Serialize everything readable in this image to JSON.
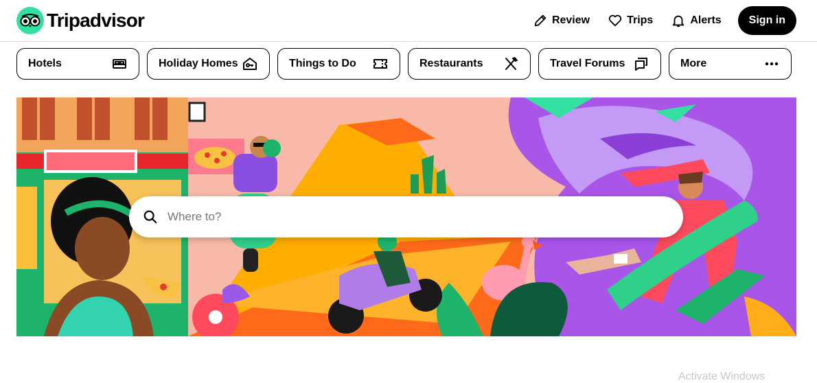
{
  "brand": {
    "name": "Tripadvisor",
    "accent": "#34e0a1"
  },
  "header_nav": [
    {
      "label": "Review",
      "icon": "pencil-icon"
    },
    {
      "label": "Trips",
      "icon": "heart-icon"
    },
    {
      "label": "Alerts",
      "icon": "bell-icon"
    }
  ],
  "signin_label": "Sign in",
  "categories": [
    {
      "label": "Hotels",
      "icon": "bed-icon"
    },
    {
      "label": "Holiday Homes",
      "icon": "house-key-icon"
    },
    {
      "label": "Things to Do",
      "icon": "ticket-icon"
    },
    {
      "label": "Restaurants",
      "icon": "fork-knife-icon"
    },
    {
      "label": "Travel Forums",
      "icon": "chat-bubbles-icon"
    },
    {
      "label": "More",
      "icon": "more-dots-icon"
    }
  ],
  "search": {
    "placeholder": "Where to?"
  },
  "watermark": "Activate Windows"
}
